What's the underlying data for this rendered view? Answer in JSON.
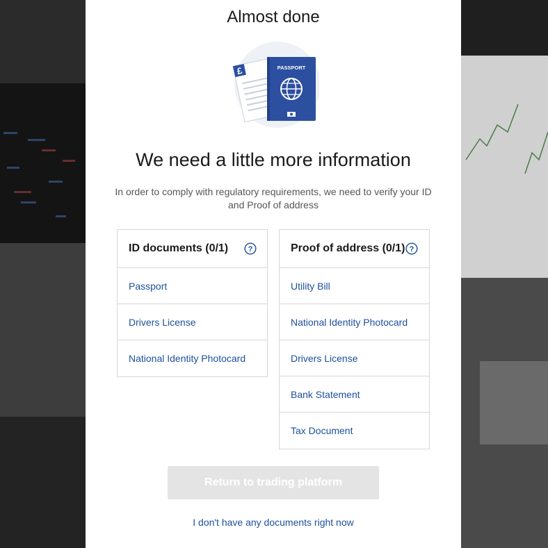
{
  "page": {
    "title": "Almost done",
    "heading": "We need a little more information",
    "description": "In order to comply with regulatory requirements, we need to verify your ID and Proof of address"
  },
  "illustration": {
    "passport_label": "PASSPORT",
    "currency_symbol": "£",
    "icon": "passport-illustration"
  },
  "id_documents": {
    "header": "ID documents (0/1)",
    "items": [
      "Passport",
      "Drivers License",
      "National Identity Photocard"
    ]
  },
  "proof_of_address": {
    "header": "Proof of address (0/1)",
    "items": [
      "Utility Bill",
      "National Identity Photocard",
      "Drivers License",
      "Bank Statement",
      "Tax Document"
    ]
  },
  "actions": {
    "return_label": "Return to trading platform",
    "no_documents_label": "I don't have any documents right now"
  },
  "colors": {
    "accent": "#1d4f9c",
    "passport_blue": "#2c4fa0",
    "disabled_button": "#e4e4e4"
  }
}
